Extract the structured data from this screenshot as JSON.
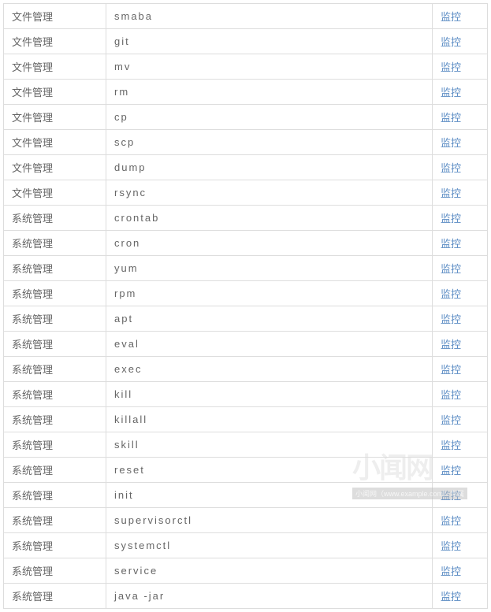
{
  "categories": {
    "file": "文件管理",
    "system": "系统管理"
  },
  "action_label": "监控",
  "rows": [
    {
      "category": "file",
      "command": "smaba"
    },
    {
      "category": "file",
      "command": "git"
    },
    {
      "category": "file",
      "command": "mv"
    },
    {
      "category": "file",
      "command": "rm"
    },
    {
      "category": "file",
      "command": "cp"
    },
    {
      "category": "file",
      "command": "scp"
    },
    {
      "category": "file",
      "command": "dump"
    },
    {
      "category": "file",
      "command": "rsync"
    },
    {
      "category": "system",
      "command": "crontab"
    },
    {
      "category": "system",
      "command": "cron"
    },
    {
      "category": "system",
      "command": "yum"
    },
    {
      "category": "system",
      "command": "rpm"
    },
    {
      "category": "system",
      "command": "apt"
    },
    {
      "category": "system",
      "command": "eval"
    },
    {
      "category": "system",
      "command": "exec"
    },
    {
      "category": "system",
      "command": "kill"
    },
    {
      "category": "system",
      "command": "killall"
    },
    {
      "category": "system",
      "command": "skill"
    },
    {
      "category": "system",
      "command": "reset"
    },
    {
      "category": "system",
      "command": "init"
    },
    {
      "category": "system",
      "command": "supervisorctl"
    },
    {
      "category": "system",
      "command": "systemctl"
    },
    {
      "category": "system",
      "command": "service"
    },
    {
      "category": "system",
      "command": "java -jar"
    }
  ],
  "watermark": {
    "text": "小闻网",
    "sub": "小闻网（www.example.com）专属"
  }
}
